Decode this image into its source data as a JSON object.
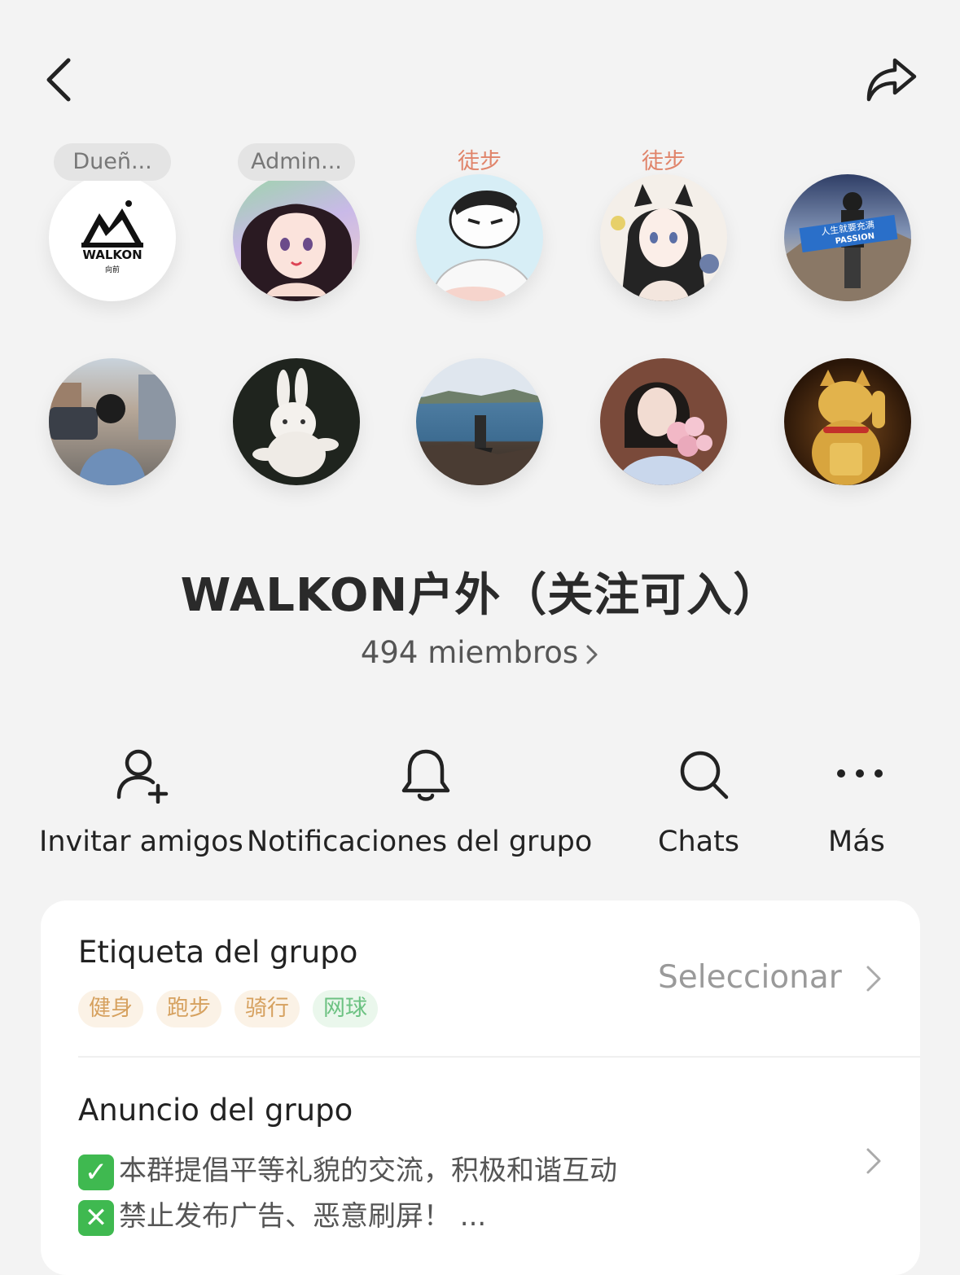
{
  "header": {
    "back_icon": "chevron-left-icon",
    "share_icon": "share-arrow-icon"
  },
  "members_grid": {
    "row1": [
      {
        "role": "Dueñ...",
        "avatar": "walkon-logo",
        "logo_text": "WALKON",
        "logo_sub": "向前"
      },
      {
        "role": "Admin...",
        "avatar": "anime-girl-portrait"
      },
      {
        "role": "徒步",
        "avatar": "cartoon-boy-hoodie"
      },
      {
        "role": "徒步",
        "avatar": "anime-cat-ear-girl"
      },
      {
        "role": "",
        "avatar": "mountain-banner-photo",
        "banner_line1": "人生就要充满",
        "banner_line2": "PASSION"
      }
    ],
    "row2": [
      {
        "avatar": "street-selfie-photo"
      },
      {
        "avatar": "white-rabbit-photo"
      },
      {
        "avatar": "lake-landscape-photo"
      },
      {
        "avatar": "girl-with-flowers-photo"
      },
      {
        "avatar": "lucky-cat-photo"
      }
    ]
  },
  "group": {
    "title": "WALKON户外（关注可入）",
    "members_label": "494 miembros"
  },
  "actions": [
    {
      "label": "Invitar amigos",
      "icon": "add-person-icon"
    },
    {
      "label": "Notificaciones del grupo",
      "icon": "bell-icon"
    },
    {
      "label": "Chats",
      "icon": "search-icon"
    },
    {
      "label": "Más",
      "icon": "more-dots-icon"
    }
  ],
  "tag_row": {
    "title": "Etiqueta del grupo",
    "action": "Seleccionar",
    "tags": [
      {
        "text": "健身",
        "color": "#d6a15f",
        "bg": "#fbf2e6"
      },
      {
        "text": "跑步",
        "color": "#d6a15f",
        "bg": "#fbf2e6"
      },
      {
        "text": "骑行",
        "color": "#d6a15f",
        "bg": "#fbf2e6"
      },
      {
        "text": "网球",
        "color": "#6cc282",
        "bg": "#eaf7ec"
      }
    ]
  },
  "announcement": {
    "title": "Anuncio del grupo",
    "line1": "本群提倡平等礼貌的交流，积极和谐互动",
    "line2": "禁止发布广告、恶意刷屏！ ...",
    "line1_icon": "check-mark-icon",
    "line2_icon": "cross-mark-icon"
  }
}
